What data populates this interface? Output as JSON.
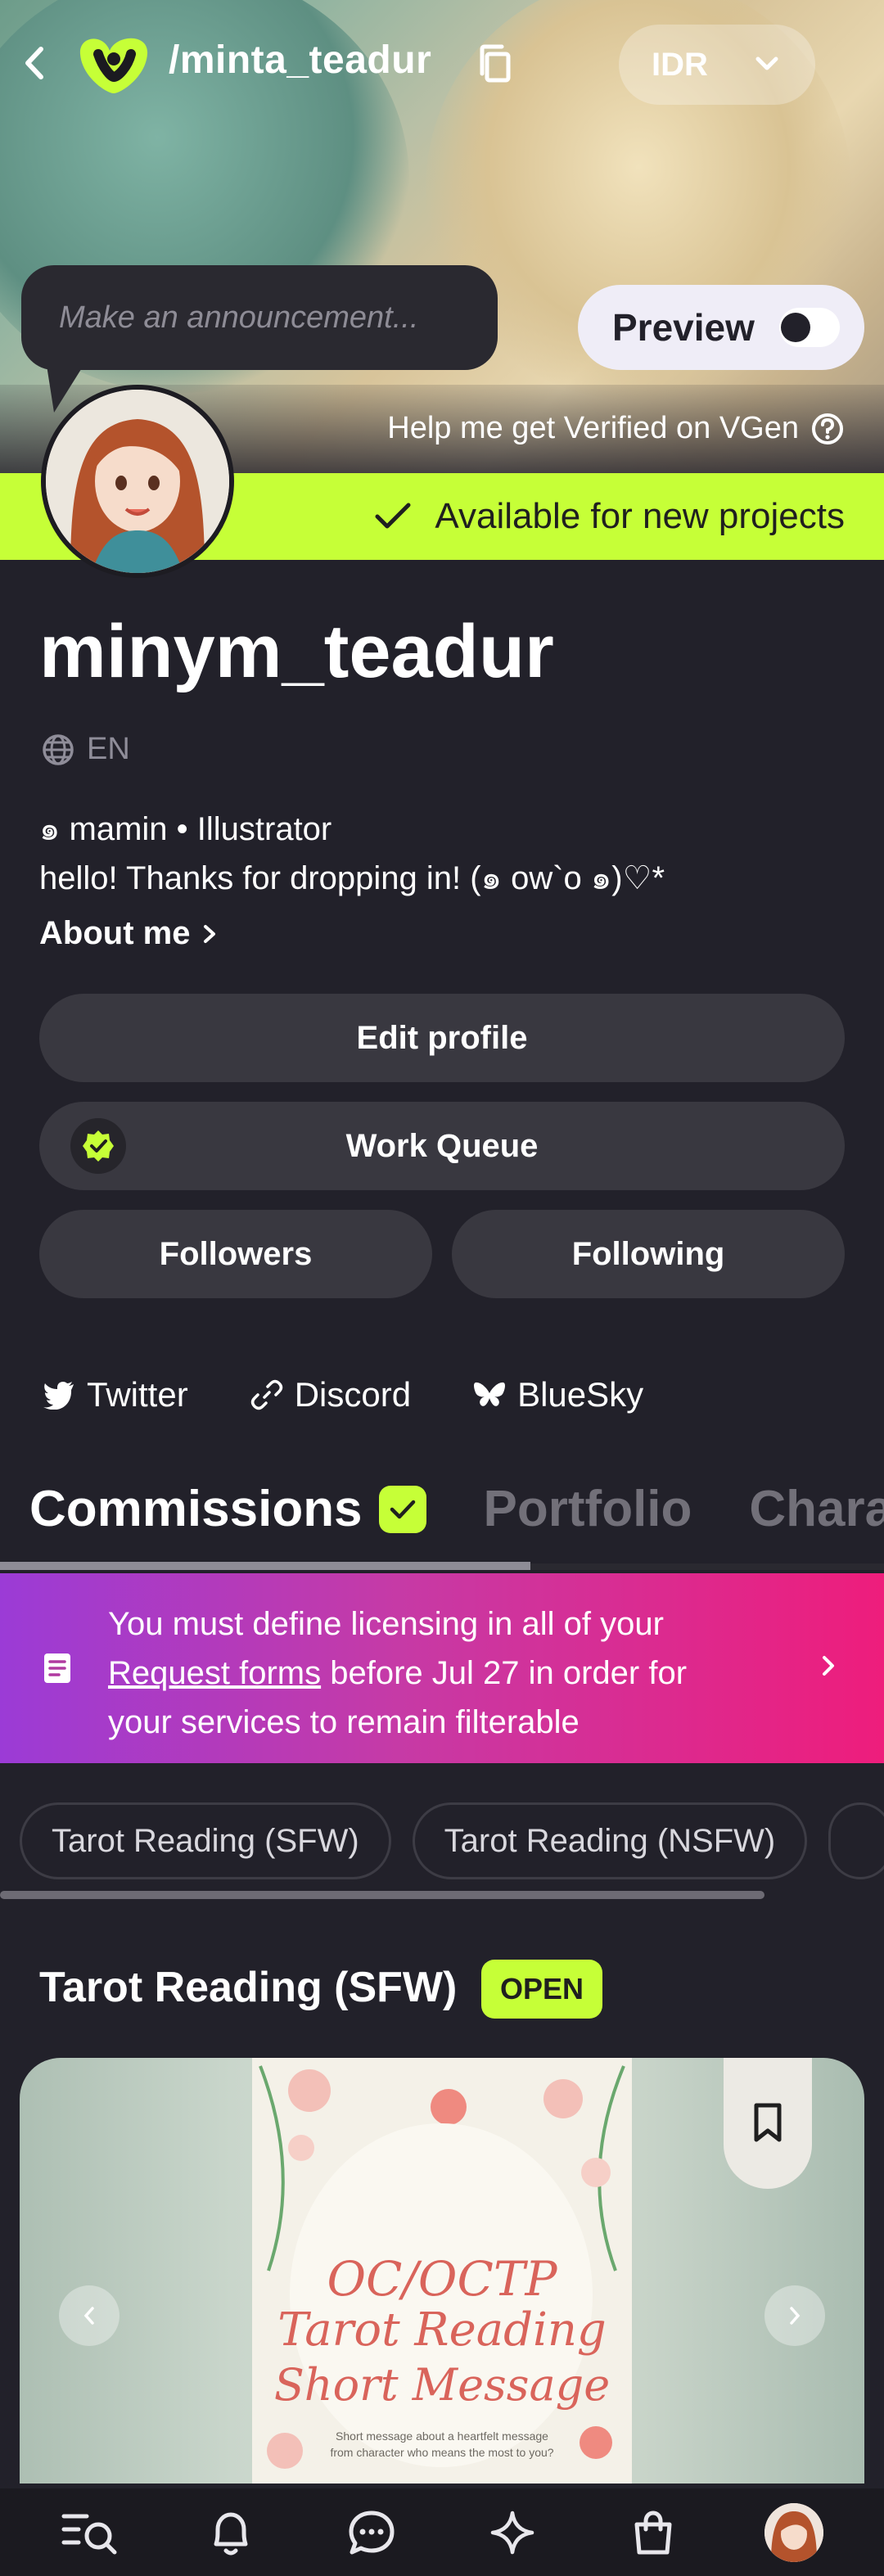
{
  "header": {
    "handle": "/minta_teadur",
    "currency": "IDR"
  },
  "announcement": {
    "placeholder": "Make an announcement..."
  },
  "preview": {
    "label": "Preview"
  },
  "verify": {
    "label": "Help me get Verified on VGen"
  },
  "availability": {
    "label": "Available for new projects"
  },
  "profile": {
    "username": "minym_teadur",
    "language": "EN",
    "bio_line1": "๑ mamin • Illustrator",
    "bio_line2": "hello! Thanks for dropping in! (๑ ow`o ๑)♡*",
    "about_label": "About me"
  },
  "buttons": {
    "edit_profile": "Edit profile",
    "work_queue": "Work Queue",
    "followers": "Followers",
    "following": "Following"
  },
  "socials": [
    {
      "label": "Twitter",
      "icon": "twitter-icon"
    },
    {
      "label": "Discord",
      "icon": "link-icon"
    },
    {
      "label": "BlueSky",
      "icon": "butterfly-icon"
    }
  ],
  "tabs": [
    {
      "label": "Commissions",
      "active": true
    },
    {
      "label": "Portfolio",
      "active": false
    },
    {
      "label": "Charac",
      "active": false
    }
  ],
  "notice": {
    "line1": "You must define licensing in all of your",
    "link": "Request forms",
    "line2_rest": " before Jul 27 in order for",
    "line3": "your services to remain filterable"
  },
  "chips": [
    "Tarot Reading (SFW)",
    "Tarot Reading (NSFW)"
  ],
  "service": {
    "title": "Tarot Reading (SFW)",
    "status": "OPEN",
    "cover_title_1": "OC/OCTP",
    "cover_title_2": "Tarot Reading",
    "cover_title_3": "Short Message",
    "cover_sub_1": "Short message about a heartfelt message",
    "cover_sub_2": "from character who means the most to you?"
  },
  "colors": {
    "accent": "#c6ff37",
    "background": "#22212a",
    "notice_start": "#9b3bd6",
    "notice_end": "#ee1d7c"
  }
}
